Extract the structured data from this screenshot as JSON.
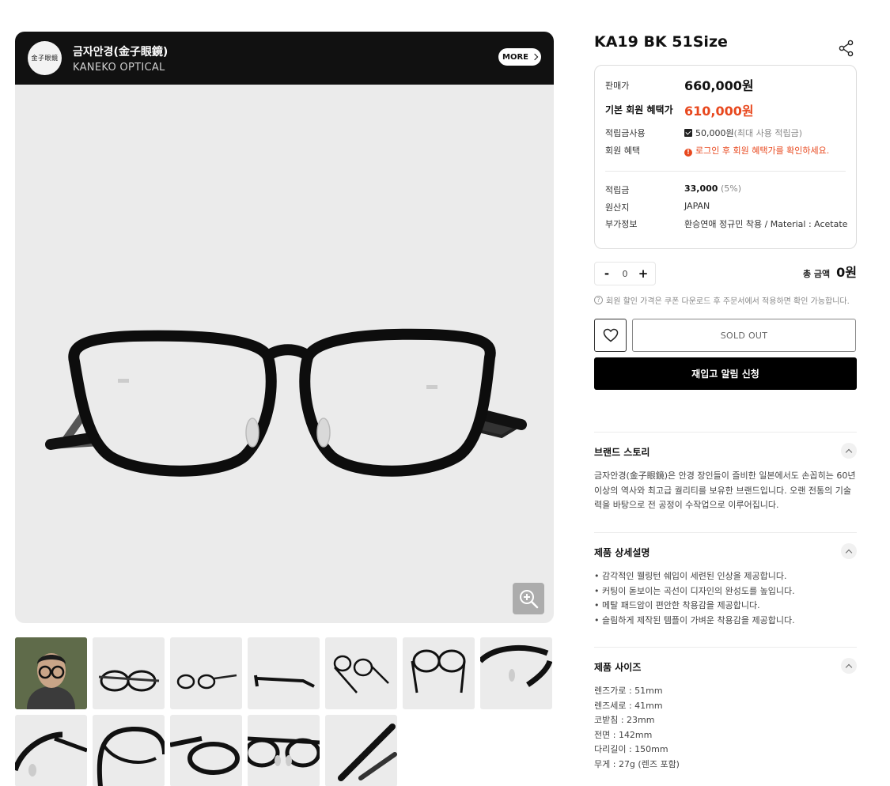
{
  "brand": {
    "logo_text": "金子眼鏡",
    "name": "금자안경(金子眼鏡)",
    "name_en": "KANEKO OPTICAL",
    "more_label": "MORE"
  },
  "product": {
    "title": "KA19 BK 51Size",
    "price_label": "판매가",
    "price": "660,000원",
    "member_price_label": "기본 회원 혜택가",
    "member_price": "610,000원",
    "points_use_label": "적립금사용",
    "points_use_value": "50,000원",
    "points_use_note": "(최대 사용 적립금)",
    "member_benefit_label": "회원 혜택",
    "member_benefit_value": "로그인 후 회원 혜택가를 확인하세요.",
    "reward_label": "적립금",
    "reward_value": "33,000",
    "reward_pct": "(5%)",
    "origin_label": "원산지",
    "origin_value": "JAPAN",
    "extra_label": "부가정보",
    "extra_value": "환승연애 정규민 착용 / Material : Acetate"
  },
  "order": {
    "qty_minus": "-",
    "qty_value": "0",
    "qty_plus": "+",
    "total_label": "총 금액",
    "total_value": "0원",
    "note": "회원 할인 가격은 쿠폰 다운로드 후 주문서에서 적용하면 확인 가능합니다.",
    "soldout_label": "SOLD OUT",
    "restock_label": "재입고 알림 신청"
  },
  "sections": {
    "brand_story": {
      "title": "브랜드 스토리",
      "body": "금자안경(金子眼鏡)은 안경 장인들이 즐비한 일본에서도 손꼽히는 60년 이상의 역사와 최고급 퀄리티를 보유한 브랜드입니다. 오랜 전통의 기술력을 바탕으로 전 공정이 수작업으로 이루어집니다."
    },
    "details": {
      "title": "제품 상세설명",
      "items": [
        "• 감각적인 웰링턴 쉐입이 세련된 인상을 제공합니다.",
        "• 커팅이 돋보이는 곡선이 디자인의 완성도를 높입니다.",
        "• 메탈 패드암이 편안한 착용감을 제공합니다.",
        "• 슬림하게 제작된 템플이 가벼운 착용감을 제공합니다."
      ]
    },
    "size": {
      "title": "제품 사이즈",
      "items": [
        "렌즈가로 : 51mm",
        "렌즈세로 : 41mm",
        "코받침 : 23mm",
        "전면 : 142mm",
        "다리길이 : 150mm",
        "무게 : 27g (렌즈 포함)"
      ]
    }
  },
  "colors": {
    "accent": "#e8481e",
    "dark": "#111111"
  }
}
